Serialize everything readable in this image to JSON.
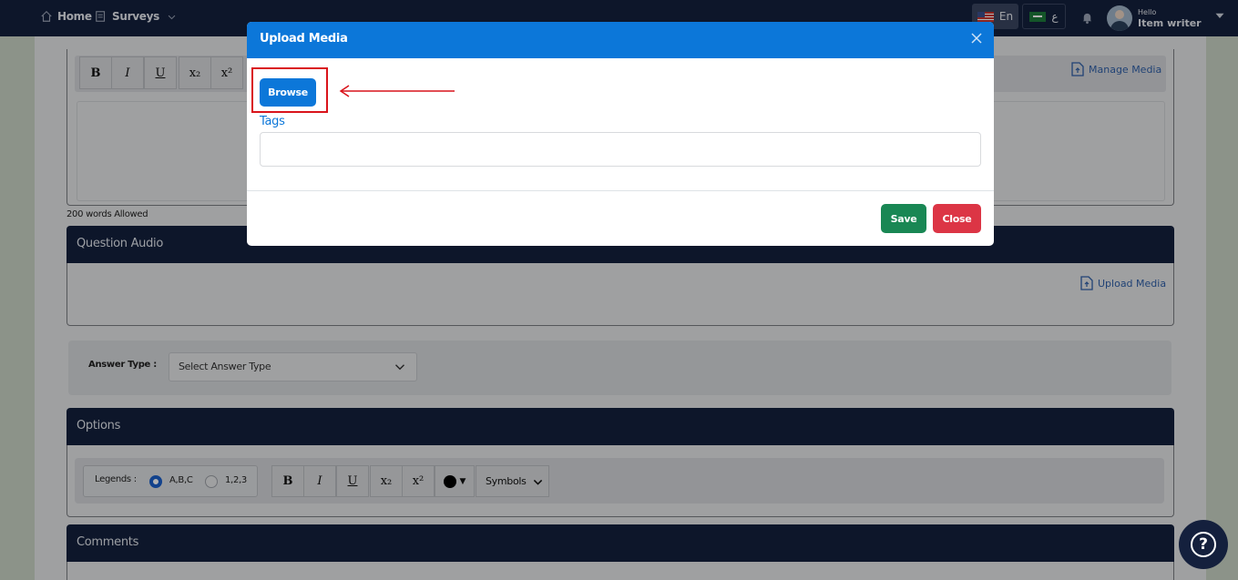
{
  "nav": {
    "home_label": "Home",
    "surveys_label": "Surveys",
    "lang_en": "En",
    "lang_ar": "ع",
    "user_greeting": "Hello",
    "user_name": "Item writer"
  },
  "editor": {
    "toolbar": [
      "B",
      "I",
      "U",
      "x₂",
      "x²"
    ],
    "manage_media_label": "Manage Media",
    "word_limit": "200 words Allowed"
  },
  "question_audio": {
    "title": "Question Audio",
    "upload_label": "Upload Media"
  },
  "answer": {
    "label": "Answer Type :",
    "select_value": "Select Answer Type"
  },
  "options": {
    "title": "Options",
    "legends_label": "Legends :",
    "legend_choices": [
      "A,B,C",
      "1,2,3"
    ],
    "legend_selected": "A,B,C",
    "toolbar": [
      "B",
      "I",
      "U",
      "x₂",
      "x²"
    ],
    "color_value": "#000000",
    "symbols_value": "Symbols"
  },
  "comments": {
    "title": "Comments"
  },
  "help": {
    "icon": "?"
  },
  "modal": {
    "title": "Upload Media",
    "browse_label": "Browse",
    "tags_label": "Tags",
    "tags_value": "",
    "save_label": "Save",
    "close_label": "Close"
  },
  "colors": {
    "navbar": "#14203d",
    "primary": "#0c77d9",
    "success": "#198754",
    "danger": "#dc3545",
    "highlight": "#d9141b"
  }
}
